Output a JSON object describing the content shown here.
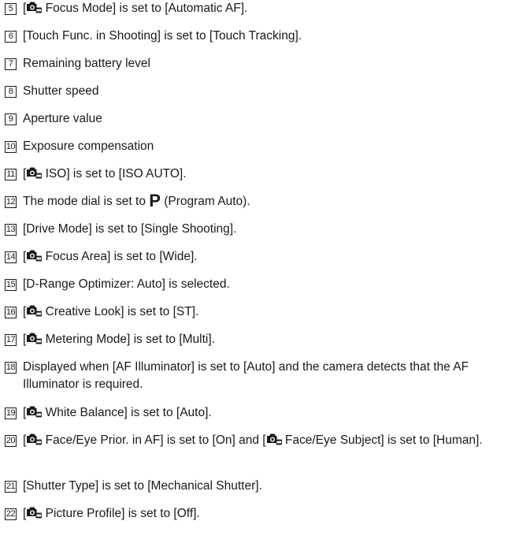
{
  "items": [
    {
      "num": "5",
      "parts": [
        [
          "t",
          "["
        ],
        [
          "i",
          "camera-still-movie-icon"
        ],
        [
          "t",
          " Focus Mode] is set to [Automatic AF]."
        ]
      ]
    },
    {
      "num": "6",
      "parts": [
        [
          "t",
          "[Touch Func. in Shooting] is set to [Touch Tracking]."
        ]
      ]
    },
    {
      "num": "7",
      "parts": [
        [
          "t",
          "Remaining battery level"
        ]
      ]
    },
    {
      "num": "8",
      "parts": [
        [
          "t",
          "Shutter speed"
        ]
      ]
    },
    {
      "num": "9",
      "parts": [
        [
          "t",
          "Aperture value"
        ]
      ]
    },
    {
      "num": "10",
      "parts": [
        [
          "t",
          "Exposure compensation"
        ]
      ]
    },
    {
      "num": "11",
      "parts": [
        [
          "t",
          "["
        ],
        [
          "i",
          "camera-still-movie-icon"
        ],
        [
          "t",
          " ISO] is set to [ISO AUTO]."
        ]
      ]
    },
    {
      "num": "12",
      "parts": [
        [
          "t",
          "The mode dial is set to "
        ],
        [
          "p",
          "P"
        ],
        [
          "t",
          " (Program Auto)."
        ]
      ]
    },
    {
      "num": "13",
      "parts": [
        [
          "t",
          "[Drive Mode] is set to [Single Shooting]."
        ]
      ]
    },
    {
      "num": "14",
      "parts": [
        [
          "t",
          "["
        ],
        [
          "i",
          "camera-still-movie-icon"
        ],
        [
          "t",
          " Focus Area] is set to [Wide]."
        ]
      ]
    },
    {
      "num": "15",
      "parts": [
        [
          "t",
          "[D-Range Optimizer: Auto] is selected."
        ]
      ]
    },
    {
      "num": "16",
      "parts": [
        [
          "t",
          "["
        ],
        [
          "i",
          "camera-still-movie-icon"
        ],
        [
          "t",
          " Creative Look] is set to [ST]."
        ]
      ]
    },
    {
      "num": "17",
      "parts": [
        [
          "t",
          "["
        ],
        [
          "i",
          "camera-still-movie-icon"
        ],
        [
          "t",
          " Metering Mode] is set to [Multi]."
        ]
      ]
    },
    {
      "num": "18",
      "parts": [
        [
          "t",
          "Displayed when [AF Illuminator] is set to [Auto] and the camera detects that the AF Illuminator is required."
        ]
      ]
    },
    {
      "num": "19",
      "parts": [
        [
          "t",
          "["
        ],
        [
          "i",
          "camera-still-movie-icon"
        ],
        [
          "t",
          " White Balance] is set to [Auto]."
        ]
      ]
    },
    {
      "num": "20",
      "parts": [
        [
          "t",
          "["
        ],
        [
          "i",
          "camera-still-movie-icon"
        ],
        [
          "t",
          " Face/Eye Prior. in AF] is set to [On] and ["
        ],
        [
          "i",
          "camera-still-movie-icon"
        ],
        [
          "t",
          " Face/Eye Subject] is set to [Human]."
        ]
      ]
    },
    {
      "num": "21",
      "parts": [
        [
          "t",
          "[Shutter Type] is set to [Mechanical Shutter]."
        ]
      ]
    },
    {
      "num": "22",
      "parts": [
        [
          "t",
          "["
        ],
        [
          "i",
          "camera-still-movie-icon"
        ],
        [
          "t",
          " Picture Profile] is set to [Off]."
        ]
      ]
    }
  ]
}
